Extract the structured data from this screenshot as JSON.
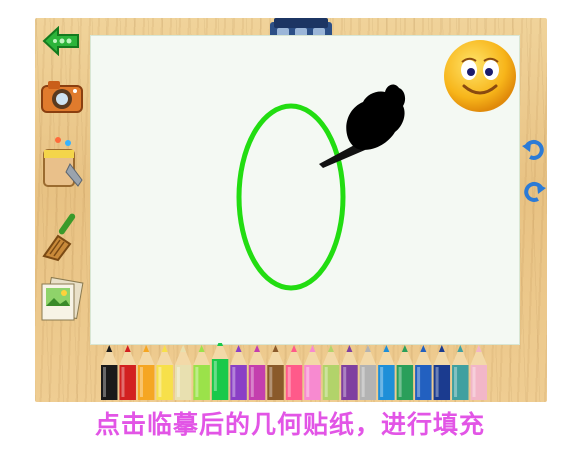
{
  "caption": "点击临摹后的几何贴纸，进行填充",
  "left_tools": [
    "back-arrow-button",
    "camera-button",
    "paint-bucket-button",
    "broom-button",
    "sticker-album-button"
  ],
  "right_tools": [
    "undo-button",
    "redo-button"
  ],
  "colors": {
    "caption": "#e255e6",
    "ellipse_stroke": "#22dd11",
    "canvas": "#f4f9f3",
    "frame": "#ecc98c"
  },
  "pencil_colors": [
    "#1a1a1a",
    "#d22020",
    "#f5a623",
    "#f7e04a",
    "#e8e0b0",
    "#9be24a",
    "#19c94a",
    "#8a3fc6",
    "#c43fae",
    "#8a5a2a",
    "#ff5a8a",
    "#f78ad0",
    "#b2d36a",
    "#7f3fa0",
    "#b3b3b3",
    "#1f8fd8",
    "#2a9f5a",
    "#2260c0",
    "#1b3b8f",
    "#3fa0a0",
    "#f2b6c8"
  ],
  "icons": {
    "back": "green-arrow-icon",
    "camera": "camera-icon",
    "bucket": "paint-bucket-icon",
    "broom": "broom-icon",
    "album": "sticker-album-icon",
    "smiley": "smiley-face-icon",
    "undo": "undo-arrow-icon",
    "redo": "redo-arrow-icon",
    "clip": "binder-clip-icon",
    "pointer": "pointing-hand-icon"
  }
}
